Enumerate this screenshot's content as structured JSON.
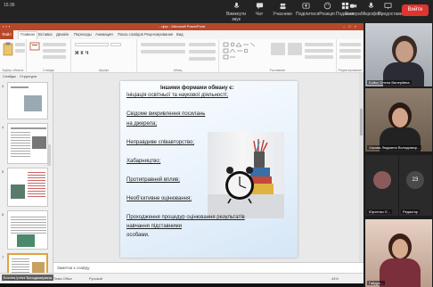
{
  "topbar": {
    "time": "15:36",
    "buttons": [
      {
        "label": "Вимкнути звук",
        "icon": "mic-icon"
      },
      {
        "label": "Чат",
        "icon": "chat-icon"
      },
      {
        "label": "Учасники",
        "icon": "people-icon"
      },
      {
        "label": "Поділитися",
        "icon": "share-icon"
      },
      {
        "label": "Реакція",
        "icon": "reaction-icon"
      },
      {
        "label": "Подання",
        "icon": "view-icon"
      },
      {
        "label": "Ще",
        "icon": "more-icon"
      },
      {
        "label": "Камера",
        "icon": "camera-icon"
      },
      {
        "label": "Мікрофон",
        "icon": "microphone-icon"
      },
      {
        "label": "Предоставить",
        "icon": "present-icon"
      }
    ],
    "exit_label": "Вийти",
    "exit_color": "#e0342f"
  },
  "ppt": {
    "title": "...ujep - Microsoft PowerPoint",
    "tabs": [
      "Файл",
      "Главная",
      "Вставка",
      "Дизайн",
      "Переходы",
      "Анимация",
      "Показ слайдов",
      "Рецензирование",
      "Вид"
    ],
    "ribbon_groups": [
      "Буфер обмена",
      "Слайды",
      "Шрифт",
      "Абзац",
      "Рисование",
      "Редактирование"
    ],
    "thumb_tabs": [
      "Слайды",
      "Структура"
    ],
    "thumb_numbers": [
      "3",
      "4",
      "5",
      "6",
      "7"
    ],
    "notes_placeholder": "Заметки к слайду",
    "status_left": "Слайд 7 из 14",
    "status_mid": "Тема Office",
    "status_lang": "Русский",
    "status_zoom": "44%",
    "accent": "#b7472a"
  },
  "slide": {
    "lines": [
      "Іншими формами обману є:",
      "Ініціація освітньої та наукової діяльності;",
      "Свідоме викривлення посилань",
      "на джерела;",
      "Неправдиве співавторство;",
      "Хабарництво;",
      "Протиправний вплив;",
      "Необ'єктивне оцінювання;",
      "Проходження процедур оцінювання результатів",
      "навчання підставними",
      "особами."
    ]
  },
  "participants": [
    {
      "name": "Бойко Олена Валеріївна"
    },
    {
      "name": "Хакова Людмила Володимир..."
    },
    {
      "name": "Юрченко Л..."
    },
    {
      "name": "Редактор"
    },
    {
      "name": "Гайдук..."
    }
  ],
  "presenter_label": "Бокова Ірина Володимирівна"
}
